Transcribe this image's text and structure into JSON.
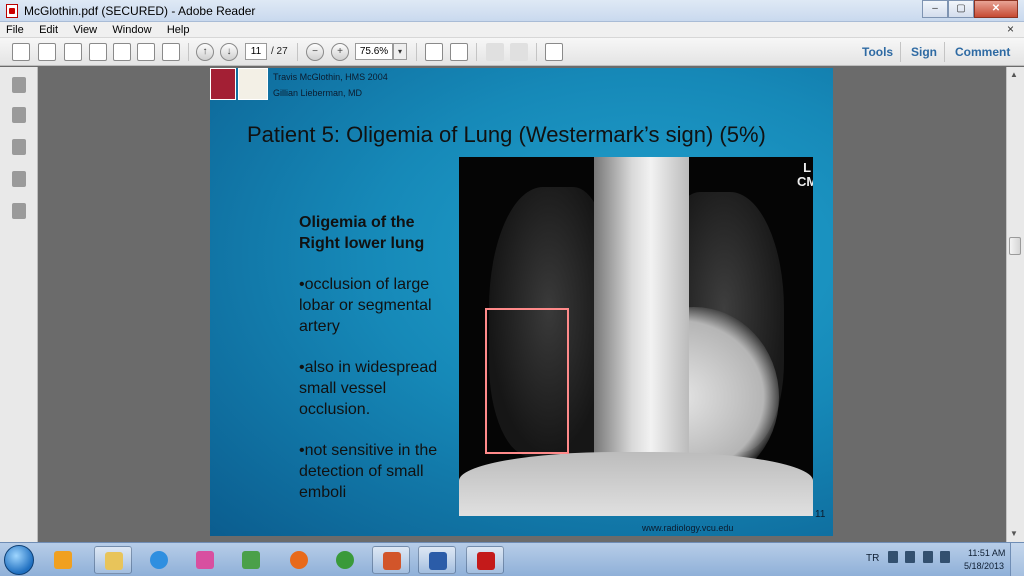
{
  "window": {
    "title": "McGlothin.pdf (SECURED) - Adobe Reader",
    "controls": {
      "minimize": "–",
      "maximize": "▢",
      "close": "✕"
    }
  },
  "menubar": {
    "items": [
      "File",
      "Edit",
      "View",
      "Window",
      "Help"
    ],
    "close_glyph": "×"
  },
  "toolbar": {
    "page_current": "11",
    "page_total": "/ 27",
    "zoom": "75.6%",
    "zoom_dropdown_glyph": "▾",
    "up_glyph": "↑",
    "down_glyph": "↓",
    "minus_glyph": "−",
    "plus_glyph": "+",
    "right_buttons": [
      "Tools",
      "Sign",
      "Comment"
    ],
    "link_color": "#2e6aa3"
  },
  "slide": {
    "author1": "Travis McGlothin, HMS 2004",
    "author2": "Gillian Lieberman, MD",
    "heading": "Patient 5: Oligemia of Lung (Westermark’s sign) (5%)",
    "subhead": "Oligemia of the Right lower lung",
    "bullets": [
      "•occlusion of large lobar or segmental artery",
      "•also in widespread small vessel occlusion.",
      "•not sensitive in the detection of small emboli"
    ],
    "xray_marker": "L\nCM",
    "page_number": "11",
    "website": "www.radiology.vcu.edu",
    "bg_color": "#1689b8",
    "roi_color": "#ff8a8a"
  },
  "taskbar": {
    "language": "TR",
    "time": "11:51 AM",
    "date": "5/18/2013",
    "apps": [
      "windows-media-player",
      "file-explorer",
      "internet-explorer",
      "paint",
      "paint-brush",
      "firefox",
      "chrome",
      "powerpoint",
      "word",
      "adobe-reader"
    ]
  }
}
